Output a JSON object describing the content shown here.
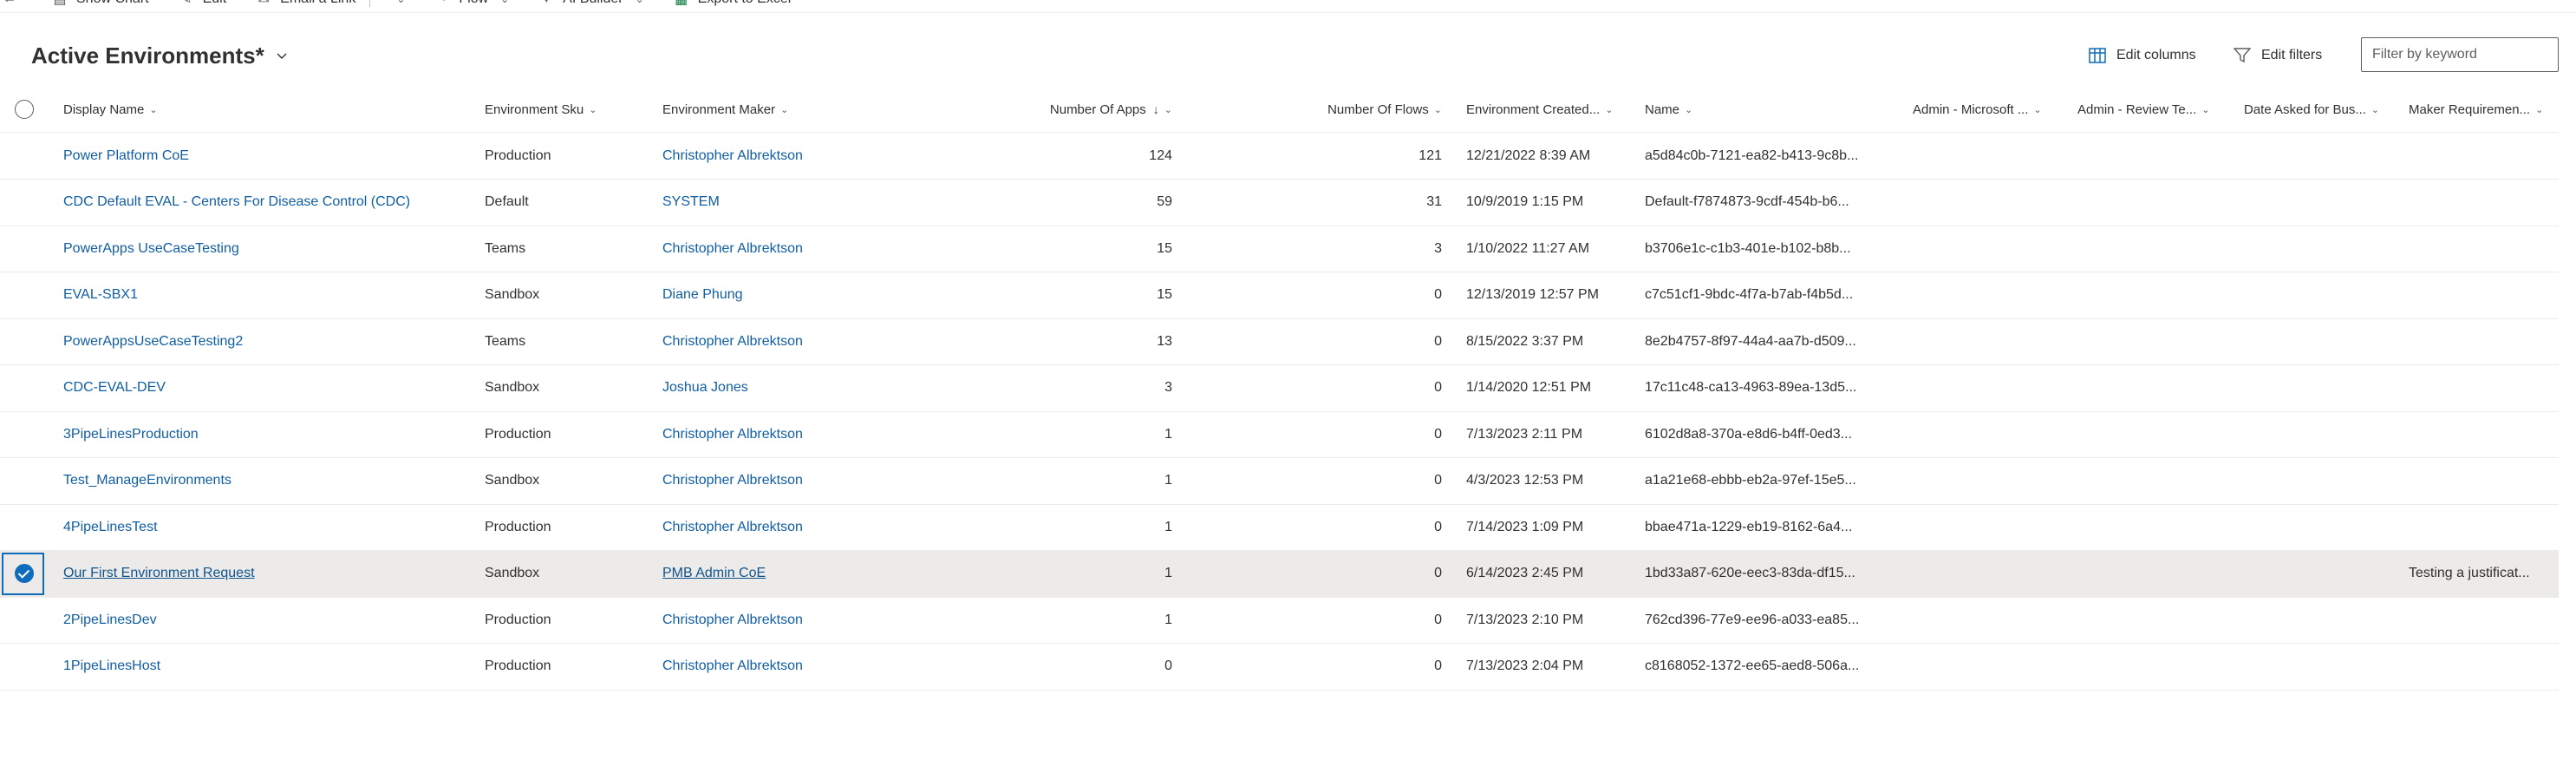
{
  "commandbar": {
    "items": [
      {
        "label": "Show Chart",
        "icon": "chart-icon"
      },
      {
        "label": "Edit",
        "icon": "pencil-icon"
      },
      {
        "label": "Email a Link",
        "icon": "email-icon"
      },
      {
        "label": "Flow",
        "icon": "flow-icon"
      },
      {
        "label": "AI Builder",
        "icon": "ai-builder-icon"
      },
      {
        "label": "Export to Excel",
        "icon": "excel-icon"
      }
    ]
  },
  "view": {
    "title": "Active Environments*",
    "edit_columns": "Edit columns",
    "edit_filters": "Edit filters",
    "filter_placeholder": "Filter by keyword"
  },
  "columns": [
    {
      "key": "display",
      "label": "Display Name"
    },
    {
      "key": "sku",
      "label": "Environment Sku"
    },
    {
      "key": "maker",
      "label": "Environment Maker"
    },
    {
      "key": "apps",
      "label": "Number Of Apps",
      "sorted": "descending"
    },
    {
      "key": "flows",
      "label": "Number Of Flows"
    },
    {
      "key": "created",
      "label": "Environment Created..."
    },
    {
      "key": "name",
      "label": "Name"
    },
    {
      "key": "admin_ms",
      "label": "Admin - Microsoft ..."
    },
    {
      "key": "admin_review",
      "label": "Admin - Review Te..."
    },
    {
      "key": "date_asked",
      "label": "Date Asked for Bus..."
    },
    {
      "key": "maker_req",
      "label": "Maker Requiremen..."
    }
  ],
  "rows": [
    {
      "display": "Power Platform CoE",
      "sku": "Production",
      "maker": "Christopher Albrektson",
      "apps": "124",
      "flows": "121",
      "created": "12/21/2022 8:39 AM",
      "name": "a5d84c0b-7121-ea82-b413-9c8b...",
      "admin_ms": "",
      "admin_review": "",
      "date_asked": "",
      "maker_req": "",
      "selected": false
    },
    {
      "display": "CDC Default EVAL - Centers For Disease Control (CDC)",
      "sku": "Default",
      "maker": "SYSTEM",
      "apps": "59",
      "flows": "31",
      "created": "10/9/2019 1:15 PM",
      "name": "Default-f7874873-9cdf-454b-b6...",
      "admin_ms": "",
      "admin_review": "",
      "date_asked": "",
      "maker_req": "",
      "selected": false
    },
    {
      "display": "PowerApps UseCaseTesting",
      "sku": "Teams",
      "maker": "Christopher Albrektson",
      "apps": "15",
      "flows": "3",
      "created": "1/10/2022 11:27 AM",
      "name": "b3706e1c-c1b3-401e-b102-b8b...",
      "admin_ms": "",
      "admin_review": "",
      "date_asked": "",
      "maker_req": "",
      "selected": false
    },
    {
      "display": "EVAL-SBX1",
      "sku": "Sandbox",
      "maker": "Diane Phung",
      "apps": "15",
      "flows": "0",
      "created": "12/13/2019 12:57 PM",
      "name": "c7c51cf1-9bdc-4f7a-b7ab-f4b5d...",
      "admin_ms": "",
      "admin_review": "",
      "date_asked": "",
      "maker_req": "",
      "selected": false
    },
    {
      "display": "PowerAppsUseCaseTesting2",
      "sku": "Teams",
      "maker": "Christopher Albrektson",
      "apps": "13",
      "flows": "0",
      "created": "8/15/2022 3:37 PM",
      "name": "8e2b4757-8f97-44a4-aa7b-d509...",
      "admin_ms": "",
      "admin_review": "",
      "date_asked": "",
      "maker_req": "",
      "selected": false
    },
    {
      "display": "CDC-EVAL-DEV",
      "sku": "Sandbox",
      "maker": "Joshua Jones",
      "apps": "3",
      "flows": "0",
      "created": "1/14/2020 12:51 PM",
      "name": "17c11c48-ca13-4963-89ea-13d5...",
      "admin_ms": "",
      "admin_review": "",
      "date_asked": "",
      "maker_req": "",
      "selected": false
    },
    {
      "display": "3PipeLinesProduction",
      "sku": "Production",
      "maker": "Christopher Albrektson",
      "apps": "1",
      "flows": "0",
      "created": "7/13/2023 2:11 PM",
      "name": "6102d8a8-370a-e8d6-b4ff-0ed3...",
      "admin_ms": "",
      "admin_review": "",
      "date_asked": "",
      "maker_req": "",
      "selected": false
    },
    {
      "display": "Test_ManageEnvironments",
      "sku": "Sandbox",
      "maker": "Christopher Albrektson",
      "apps": "1",
      "flows": "0",
      "created": "4/3/2023 12:53 PM",
      "name": "a1a21e68-ebbb-eb2a-97ef-15e5...",
      "admin_ms": "",
      "admin_review": "",
      "date_asked": "",
      "maker_req": "",
      "selected": false
    },
    {
      "display": "4PipeLinesTest",
      "sku": "Production",
      "maker": "Christopher Albrektson",
      "apps": "1",
      "flows": "0",
      "created": "7/14/2023 1:09 PM",
      "name": "bbae471a-1229-eb19-8162-6a4...",
      "admin_ms": "",
      "admin_review": "",
      "date_asked": "",
      "maker_req": "",
      "selected": false
    },
    {
      "display": "Our First Environment Request",
      "sku": "Sandbox",
      "maker": "PMB Admin CoE",
      "apps": "1",
      "flows": "0",
      "created": "6/14/2023 2:45 PM",
      "name": "1bd33a87-620e-eec3-83da-df15...",
      "admin_ms": "",
      "admin_review": "",
      "date_asked": "",
      "maker_req": "Testing a justificat...",
      "selected": true
    },
    {
      "display": "2PipeLinesDev",
      "sku": "Production",
      "maker": "Christopher Albrektson",
      "apps": "1",
      "flows": "0",
      "created": "7/13/2023 2:10 PM",
      "name": "762cd396-77e9-ee96-a033-ea85...",
      "admin_ms": "",
      "admin_review": "",
      "date_asked": "",
      "maker_req": "",
      "selected": false
    },
    {
      "display": "1PipeLinesHost",
      "sku": "Production",
      "maker": "Christopher Albrektson",
      "apps": "0",
      "flows": "0",
      "created": "7/13/2023 2:04 PM",
      "name": "c8168052-1372-ee65-aed8-506a...",
      "admin_ms": "",
      "admin_review": "",
      "date_asked": "",
      "maker_req": "",
      "selected": false
    }
  ],
  "colors": {
    "link": "#115ea3",
    "accent": "#0f6cbd",
    "selected_row": "#edebe9",
    "excel": "#107c41"
  }
}
